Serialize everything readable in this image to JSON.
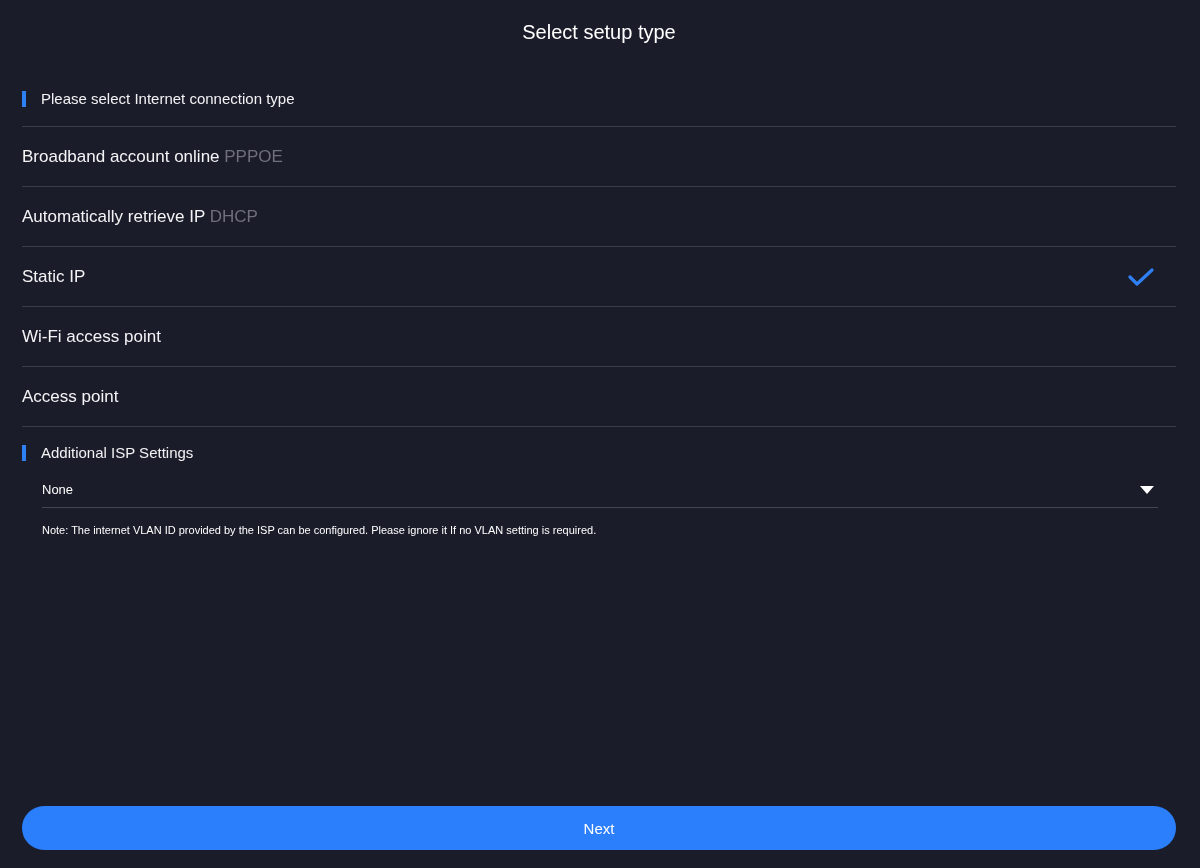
{
  "page": {
    "title": "Select setup type"
  },
  "connection_section": {
    "heading": "Please select Internet connection type",
    "options": [
      {
        "label": "Broadband account online",
        "protocol": "PPPOE",
        "selected": false
      },
      {
        "label": "Automatically retrieve IP",
        "protocol": "DHCP",
        "selected": false
      },
      {
        "label": "Static IP",
        "selected": true
      },
      {
        "label": "Wi-Fi access point",
        "selected": false
      },
      {
        "label": "Access point",
        "selected": false
      }
    ]
  },
  "isp_section": {
    "heading": "Additional ISP Settings",
    "dropdown": {
      "value": "None"
    },
    "note": "Note: The internet VLAN ID provided by the ISP can be configured. Please ignore it If no VLAN setting is required."
  },
  "next_button": {
    "label": "Next"
  }
}
